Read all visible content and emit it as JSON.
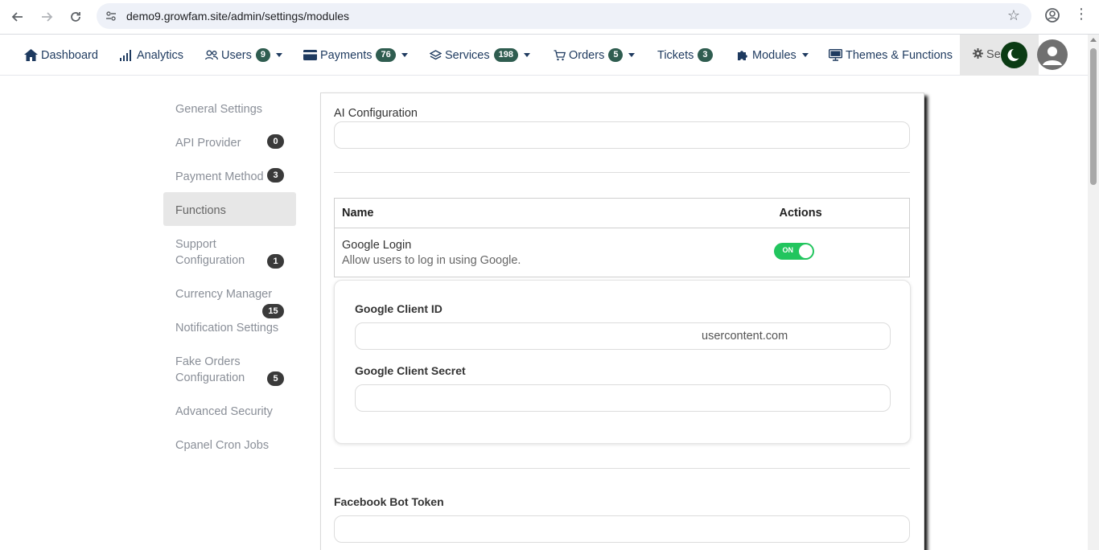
{
  "browser": {
    "url": "demo9.growfam.site/admin/settings/modules"
  },
  "topnav": {
    "items": [
      {
        "label": "Dashboard"
      },
      {
        "label": "Analytics"
      },
      {
        "label": "Users",
        "badge": "9"
      },
      {
        "label": "Payments",
        "badge": "76"
      },
      {
        "label": "Services",
        "badge": "198"
      },
      {
        "label": "Orders",
        "badge": "5"
      },
      {
        "label": "Tickets",
        "badge": "3"
      },
      {
        "label": "Modules"
      },
      {
        "label": "Themes & Functions"
      }
    ],
    "settings_label": "Se"
  },
  "sidebar": {
    "items": [
      {
        "label": "General Settings"
      },
      {
        "label": "API Provider",
        "badge": "0"
      },
      {
        "label": "Payment Method",
        "badge": "3"
      },
      {
        "label": "Functions",
        "active": true
      },
      {
        "label_line1": "Support",
        "label_line2": "Configuration",
        "badge": "1"
      },
      {
        "label": "Currency Manager",
        "badge": "15"
      },
      {
        "label": "Notification Settings"
      },
      {
        "label_line1": "Fake Orders",
        "label_line2": "Configuration",
        "badge": "5"
      },
      {
        "label": "Advanced Security"
      },
      {
        "label": "Cpanel Cron Jobs"
      }
    ]
  },
  "main": {
    "ai_configuration_label": "AI Configuration",
    "ai_configuration_value": "",
    "table": {
      "header_name": "Name",
      "header_actions": "Actions",
      "row_name": "Google Login",
      "row_desc": "Allow users to log in using Google.",
      "toggle_label": "ON"
    },
    "google": {
      "client_id_label": "Google Client ID",
      "client_id_value": "usercontent.com",
      "client_secret_label": "Google Client Secret",
      "client_secret_value": ""
    },
    "facebook_bot_token_label": "Facebook Bot Token",
    "facebook_bot_token_value": ""
  },
  "colors": {
    "nav_text": "#1e3a5f",
    "badge_nav": "#2f5d50",
    "toggle_on": "#22c55e",
    "badge_side": "#3a3a3a"
  }
}
